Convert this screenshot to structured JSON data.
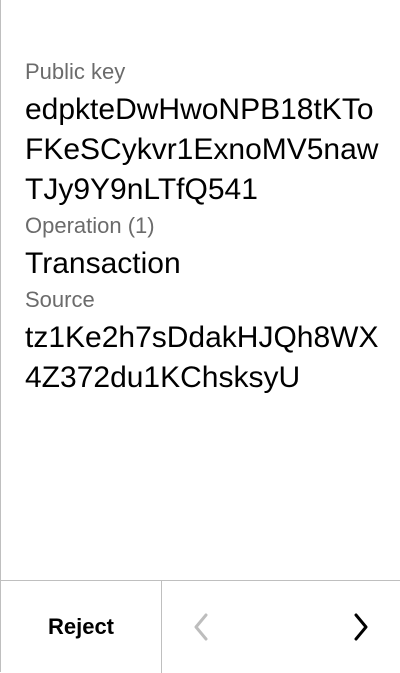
{
  "fields": [
    {
      "label": "Public key",
      "value": "edpkteDwHwoNPB18tKToFKeSCykvr1ExnoMV5nawTJy9Y9nLTfQ541"
    },
    {
      "label": "Operation (1)",
      "value": "Transaction"
    },
    {
      "label": "Source",
      "value": "tz1Ke2h7sDdakHJQh8WX4Z372du1KChsksyU"
    }
  ],
  "footer": {
    "reject_label": "Reject",
    "prev_icon": "chevron-left-icon",
    "next_icon": "chevron-right-icon",
    "prev_color": "#bdbdbd",
    "next_color": "#000000"
  }
}
